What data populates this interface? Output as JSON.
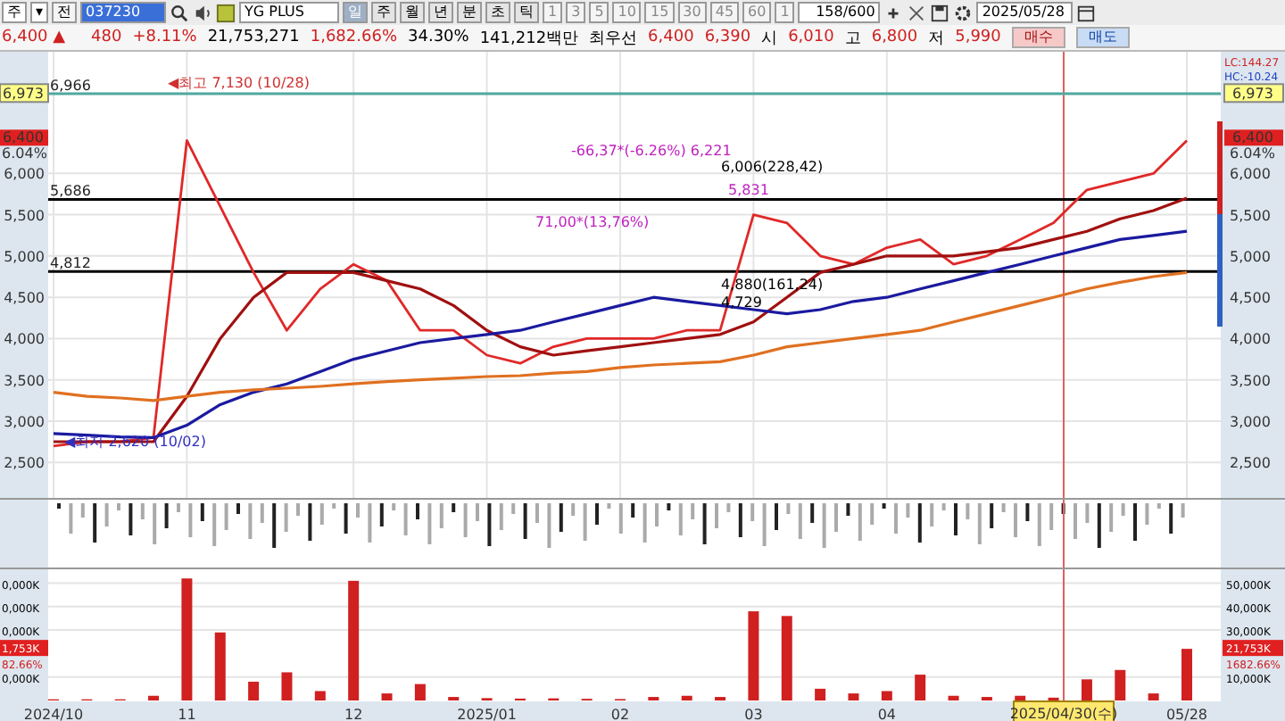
{
  "toolbar": {
    "market": "주",
    "dropdown": "▾",
    "all_button": "전",
    "code": "037230",
    "name": "YG PLUS",
    "periods": [
      {
        "label": "일",
        "selected": true
      },
      {
        "label": "주",
        "selected": false
      },
      {
        "label": "월",
        "selected": false
      },
      {
        "label": "년",
        "selected": false
      },
      {
        "label": "분",
        "selected": false
      },
      {
        "label": "초",
        "selected": false
      },
      {
        "label": "틱",
        "selected": false
      }
    ],
    "intervals": [
      "1",
      "3",
      "5",
      "10",
      "15",
      "30",
      "45",
      "60"
    ],
    "unit": "1",
    "count": "158/600",
    "date": "2025/05/28"
  },
  "quote": {
    "price": "6,400 ▲",
    "change": "480",
    "rate": "+8.11%",
    "volume": "21,753,271",
    "volume_rate": "1,682.66%",
    "turnover": "34.30%",
    "amount": "141,212백만",
    "best_label": "최우선",
    "ask": "6,400",
    "bid": "6,390",
    "open_label": "시",
    "open": "6,010",
    "high_label": "고",
    "high": "6,800",
    "low_label": "저",
    "low": "5,990",
    "buy": "매수",
    "sell": "매도"
  },
  "price_chart": {
    "chart_data": {
      "type": "line",
      "grid": true,
      "categories": [
        null,
        null,
        null,
        null,
        null,
        null,
        null,
        null,
        null,
        null,
        null,
        null,
        null,
        null,
        null,
        null,
        null,
        null,
        null,
        null,
        null,
        null,
        null,
        null,
        null,
        null,
        null,
        null,
        null,
        null,
        null,
        null,
        null,
        null,
        null
      ],
      "ylim": [
        2070,
        7430
      ],
      "yticks": [
        {
          "value": 2500,
          "label": "2,500"
        },
        {
          "value": 3000,
          "label": "3,000"
        },
        {
          "value": 3500,
          "label": "3,500"
        },
        {
          "value": 4000,
          "label": "4,000"
        },
        {
          "value": 4500,
          "label": "4,500"
        },
        {
          "value": 5000,
          "label": "5,000"
        },
        {
          "value": 5500,
          "label": "5,500"
        },
        {
          "value": 6000,
          "label": "6,000"
        }
      ],
      "series": [
        {
          "color": "#e02828",
          "values": [
            2700,
            2750,
            2750,
            2800,
            6400,
            5600,
            4800,
            4100,
            4600,
            4900,
            4700,
            4100,
            4100,
            3800,
            3700,
            3900,
            4000,
            4000,
            4000,
            4100,
            4100,
            5500,
            5400,
            5000,
            4900,
            5100,
            5200,
            4900,
            5000,
            5200,
            5400,
            5800,
            5900,
            6000,
            6400
          ]
        },
        {
          "color": "#a01010",
          "values": [
            2750,
            2750,
            2750,
            2750,
            3300,
            4000,
            4500,
            4800,
            4800,
            4800,
            4700,
            4600,
            4400,
            4100,
            3900,
            3800,
            3850,
            3900,
            3950,
            4000,
            4050,
            4200,
            4500,
            4800,
            4900,
            5000,
            5000,
            5000,
            5050,
            5100,
            5200,
            5300,
            5450,
            5550,
            5700
          ]
        },
        {
          "color": "#1a1aa0",
          "values": [
            2850,
            2830,
            2810,
            2800,
            2950,
            3200,
            3350,
            3450,
            3600,
            3750,
            3850,
            3950,
            4000,
            4050,
            4100,
            4200,
            4300,
            4400,
            4500,
            4450,
            4400,
            4350,
            4300,
            4350,
            4450,
            4500,
            4600,
            4700,
            4800,
            4900,
            5000,
            5100,
            5200,
            5250,
            5300
          ]
        },
        {
          "color": "#e07020",
          "values": [
            3350,
            3300,
            3280,
            3250,
            3300,
            3350,
            3380,
            3400,
            3420,
            3450,
            3480,
            3500,
            3520,
            3540,
            3550,
            3580,
            3600,
            3650,
            3680,
            3700,
            3720,
            3800,
            3900,
            3950,
            4000,
            4050,
            4100,
            4200,
            4300,
            4400,
            4500,
            4600,
            4680,
            4750,
            4800
          ]
        }
      ],
      "ref_lines": [
        {
          "axis": "y",
          "value": 6966,
          "label": "6,966",
          "color": "#4fa8a0"
        },
        {
          "axis": "y",
          "value": 5686,
          "label": "5,686",
          "color": "#000000"
        },
        {
          "axis": "y",
          "value": 4812,
          "label": "4,812",
          "color": "#000000"
        }
      ]
    },
    "notes": [
      {
        "label": "◀최고 7,130 (10/28)",
        "color": "#d03030"
      },
      {
        "label": "◀최저 2,620 (10/02)",
        "color": "#3030c0"
      },
      {
        "label": "-66,37*(-6.26%) 6,221",
        "color": "#c020c0"
      },
      {
        "label": "6,006(228,42)",
        "color": "#000000"
      },
      {
        "label": "5,831",
        "color": "#c020c0"
      },
      {
        "label": "71,00*(13,76%)",
        "color": "#c020c0"
      },
      {
        "label": "4,880(161,24)",
        "color": "#000000"
      },
      {
        "label": "4,729",
        "color": "#000000"
      }
    ],
    "left_marker": "6,973",
    "right_marker": "6,973",
    "left_last_price": "6,400",
    "left_last_rate": "6.04%",
    "last_price": "6,400",
    "last_rate": "6.04%",
    "lc": "LC:144.27",
    "hc": "HC:-10.24"
  },
  "volume_chart": {
    "chart_data": {
      "type": "bar",
      "grid": true,
      "categories": [
        "2024/10",
        null,
        null,
        null,
        "11",
        null,
        null,
        null,
        null,
        "12",
        null,
        null,
        null,
        "2025/01",
        null,
        null,
        null,
        "02",
        null,
        null,
        null,
        "03",
        null,
        null,
        null,
        "04",
        null,
        null,
        null,
        null,
        null,
        null,
        null,
        null,
        "05/28"
      ],
      "ylim": [
        0,
        54000
      ],
      "yticks": [
        {
          "value": 10000,
          "label": "10,000K"
        },
        {
          "value": 30000,
          "label": "30,000K"
        },
        {
          "value": 40000,
          "label": "40,000K"
        },
        {
          "value": 50000,
          "label": "50,000K"
        }
      ],
      "series": [
        {
          "color": "#d02020",
          "values": [
            500,
            500,
            500,
            2000,
            52000,
            29000,
            8000,
            12000,
            4000,
            51000,
            3000,
            7000,
            1500,
            1000,
            800,
            900,
            700,
            600,
            1500,
            2000,
            1500,
            38000,
            36000,
            5000,
            3000,
            4000,
            11000,
            2000,
            1500,
            2000,
            1200,
            9000,
            13000,
            3000,
            22000
          ]
        }
      ]
    },
    "left_labels": [
      "0,000K",
      "0,000K",
      "0,000K",
      "0,000K"
    ],
    "left_volume": "1,753K",
    "left_volume_rate": "82.66%",
    "last_volume": "21,753K",
    "last_volume_rate": "1682.66%"
  },
  "cursor": {
    "label": "2025/04/30(수)"
  }
}
